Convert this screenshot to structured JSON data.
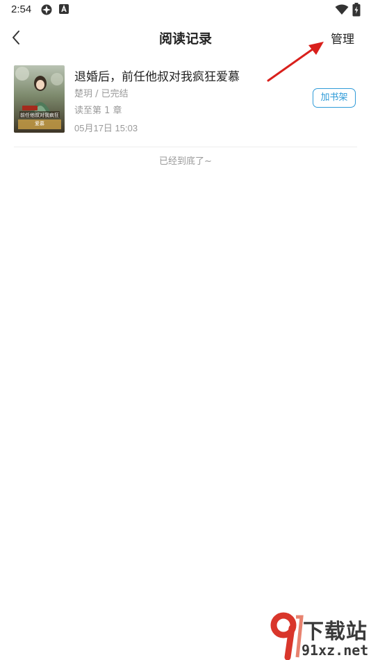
{
  "status_bar": {
    "time": "2:54",
    "icons": [
      "signal-app-icon",
      "accessibility-icon",
      "wifi-icon",
      "battery-icon"
    ]
  },
  "header": {
    "title": "阅读记录",
    "manage_label": "管理",
    "back_icon": "chevron-left-icon"
  },
  "history": [
    {
      "title": "退婚后，前任他叔对我疯狂爱慕",
      "author_status": "楚玥 / 已完结",
      "progress": "读至第 1 章",
      "read_time": "05月17日 15:03",
      "add_button": "加书架",
      "cover_text": "前任他叔对我疯狂爱慕"
    }
  ],
  "footer_text": "已经到底了~",
  "watermark": {
    "brand": "下载站",
    "domain": "91xz.net"
  },
  "colors": {
    "accent": "#2f9bd8",
    "annotation_arrow": "#d9201c",
    "watermark_red": "#d9362b"
  }
}
